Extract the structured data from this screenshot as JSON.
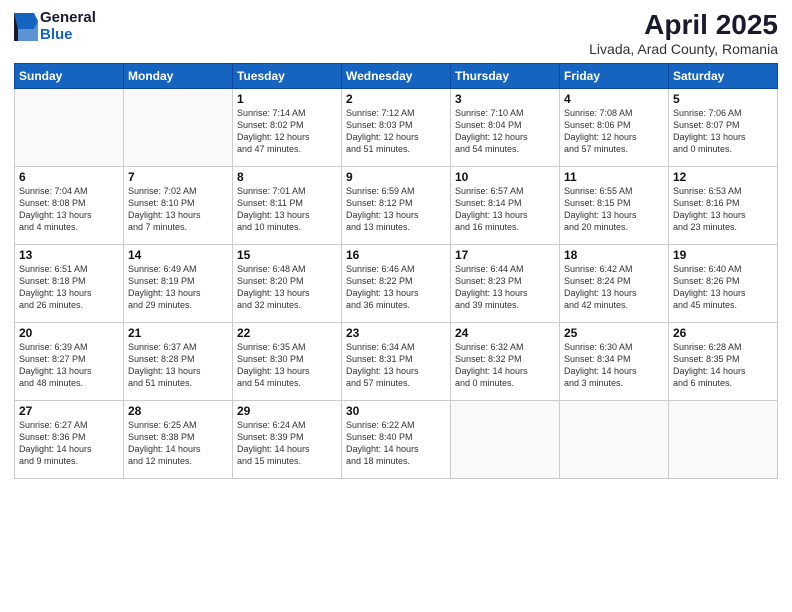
{
  "logo": {
    "general": "General",
    "blue": "Blue"
  },
  "title": "April 2025",
  "subtitle": "Livada, Arad County, Romania",
  "headers": [
    "Sunday",
    "Monday",
    "Tuesday",
    "Wednesday",
    "Thursday",
    "Friday",
    "Saturday"
  ],
  "weeks": [
    [
      {
        "day": "",
        "info": ""
      },
      {
        "day": "",
        "info": ""
      },
      {
        "day": "1",
        "info": "Sunrise: 7:14 AM\nSunset: 8:02 PM\nDaylight: 12 hours\nand 47 minutes."
      },
      {
        "day": "2",
        "info": "Sunrise: 7:12 AM\nSunset: 8:03 PM\nDaylight: 12 hours\nand 51 minutes."
      },
      {
        "day": "3",
        "info": "Sunrise: 7:10 AM\nSunset: 8:04 PM\nDaylight: 12 hours\nand 54 minutes."
      },
      {
        "day": "4",
        "info": "Sunrise: 7:08 AM\nSunset: 8:06 PM\nDaylight: 12 hours\nand 57 minutes."
      },
      {
        "day": "5",
        "info": "Sunrise: 7:06 AM\nSunset: 8:07 PM\nDaylight: 13 hours\nand 0 minutes."
      }
    ],
    [
      {
        "day": "6",
        "info": "Sunrise: 7:04 AM\nSunset: 8:08 PM\nDaylight: 13 hours\nand 4 minutes."
      },
      {
        "day": "7",
        "info": "Sunrise: 7:02 AM\nSunset: 8:10 PM\nDaylight: 13 hours\nand 7 minutes."
      },
      {
        "day": "8",
        "info": "Sunrise: 7:01 AM\nSunset: 8:11 PM\nDaylight: 13 hours\nand 10 minutes."
      },
      {
        "day": "9",
        "info": "Sunrise: 6:59 AM\nSunset: 8:12 PM\nDaylight: 13 hours\nand 13 minutes."
      },
      {
        "day": "10",
        "info": "Sunrise: 6:57 AM\nSunset: 8:14 PM\nDaylight: 13 hours\nand 16 minutes."
      },
      {
        "day": "11",
        "info": "Sunrise: 6:55 AM\nSunset: 8:15 PM\nDaylight: 13 hours\nand 20 minutes."
      },
      {
        "day": "12",
        "info": "Sunrise: 6:53 AM\nSunset: 8:16 PM\nDaylight: 13 hours\nand 23 minutes."
      }
    ],
    [
      {
        "day": "13",
        "info": "Sunrise: 6:51 AM\nSunset: 8:18 PM\nDaylight: 13 hours\nand 26 minutes."
      },
      {
        "day": "14",
        "info": "Sunrise: 6:49 AM\nSunset: 8:19 PM\nDaylight: 13 hours\nand 29 minutes."
      },
      {
        "day": "15",
        "info": "Sunrise: 6:48 AM\nSunset: 8:20 PM\nDaylight: 13 hours\nand 32 minutes."
      },
      {
        "day": "16",
        "info": "Sunrise: 6:46 AM\nSunset: 8:22 PM\nDaylight: 13 hours\nand 36 minutes."
      },
      {
        "day": "17",
        "info": "Sunrise: 6:44 AM\nSunset: 8:23 PM\nDaylight: 13 hours\nand 39 minutes."
      },
      {
        "day": "18",
        "info": "Sunrise: 6:42 AM\nSunset: 8:24 PM\nDaylight: 13 hours\nand 42 minutes."
      },
      {
        "day": "19",
        "info": "Sunrise: 6:40 AM\nSunset: 8:26 PM\nDaylight: 13 hours\nand 45 minutes."
      }
    ],
    [
      {
        "day": "20",
        "info": "Sunrise: 6:39 AM\nSunset: 8:27 PM\nDaylight: 13 hours\nand 48 minutes."
      },
      {
        "day": "21",
        "info": "Sunrise: 6:37 AM\nSunset: 8:28 PM\nDaylight: 13 hours\nand 51 minutes."
      },
      {
        "day": "22",
        "info": "Sunrise: 6:35 AM\nSunset: 8:30 PM\nDaylight: 13 hours\nand 54 minutes."
      },
      {
        "day": "23",
        "info": "Sunrise: 6:34 AM\nSunset: 8:31 PM\nDaylight: 13 hours\nand 57 minutes."
      },
      {
        "day": "24",
        "info": "Sunrise: 6:32 AM\nSunset: 8:32 PM\nDaylight: 14 hours\nand 0 minutes."
      },
      {
        "day": "25",
        "info": "Sunrise: 6:30 AM\nSunset: 8:34 PM\nDaylight: 14 hours\nand 3 minutes."
      },
      {
        "day": "26",
        "info": "Sunrise: 6:28 AM\nSunset: 8:35 PM\nDaylight: 14 hours\nand 6 minutes."
      }
    ],
    [
      {
        "day": "27",
        "info": "Sunrise: 6:27 AM\nSunset: 8:36 PM\nDaylight: 14 hours\nand 9 minutes."
      },
      {
        "day": "28",
        "info": "Sunrise: 6:25 AM\nSunset: 8:38 PM\nDaylight: 14 hours\nand 12 minutes."
      },
      {
        "day": "29",
        "info": "Sunrise: 6:24 AM\nSunset: 8:39 PM\nDaylight: 14 hours\nand 15 minutes."
      },
      {
        "day": "30",
        "info": "Sunrise: 6:22 AM\nSunset: 8:40 PM\nDaylight: 14 hours\nand 18 minutes."
      },
      {
        "day": "",
        "info": ""
      },
      {
        "day": "",
        "info": ""
      },
      {
        "day": "",
        "info": ""
      }
    ]
  ]
}
